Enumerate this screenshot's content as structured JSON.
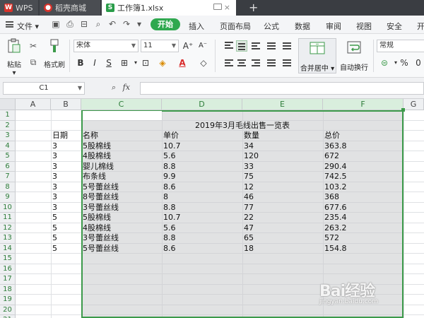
{
  "tabs": [
    {
      "label": "WPS"
    },
    {
      "label": "稻壳商城"
    },
    {
      "label": "工作簿1.xlsx"
    }
  ],
  "tab_close": "×",
  "new_tab": "+",
  "menu": {
    "file": "文件",
    "start": "开始",
    "items": [
      "插入",
      "页面布局",
      "公式",
      "数据",
      "审阅",
      "视图",
      "安全",
      "开"
    ]
  },
  "ribbon": {
    "paste": "粘贴",
    "format_painter": "格式刷",
    "font_name": "宋体",
    "font_size": "11",
    "grow_font": "A⁺",
    "shrink_font": "A⁻",
    "bold": "B",
    "italic": "I",
    "underline": "S",
    "merge_center": "合并居中",
    "wrap_text": "自动换行",
    "number_format": "常规",
    "percent": "%",
    "comma": "0"
  },
  "formula_bar": {
    "cell_ref": "C1",
    "fx": "fx"
  },
  "columns": [
    "A",
    "B",
    "C",
    "D",
    "E",
    "F",
    "G"
  ],
  "rows": [
    "1",
    "2",
    "3",
    "4",
    "5",
    "6",
    "7",
    "8",
    "9",
    "10",
    "11",
    "12",
    "13",
    "14",
    "15",
    "16",
    "17",
    "18",
    "19",
    "20",
    "21"
  ],
  "sheet": {
    "title": "2019年3月毛线出售一览表",
    "header": {
      "date": "日期",
      "name": "名称",
      "price": "单价",
      "qty": "数量",
      "total": "总价"
    },
    "records": [
      {
        "date": "3",
        "name": "5股棉线",
        "price": "10.7",
        "qty": "34",
        "total": "363.8"
      },
      {
        "date": "3",
        "name": "4股棉线",
        "price": "5.6",
        "qty": "120",
        "total": "672"
      },
      {
        "date": "3",
        "name": "婴儿棉线",
        "price": "8.8",
        "qty": "33",
        "total": "290.4"
      },
      {
        "date": "3",
        "name": "布条线",
        "price": "9.9",
        "qty": "75",
        "total": "742.5"
      },
      {
        "date": "3",
        "name": "5号蕾丝线",
        "price": "8.6",
        "qty": "12",
        "total": "103.2"
      },
      {
        "date": "3",
        "name": "8号蕾丝线",
        "price": "8",
        "qty": "46",
        "total": "368"
      },
      {
        "date": "3",
        "name": "3号蕾丝线",
        "price": "8.8",
        "qty": "77",
        "total": "677.6"
      },
      {
        "date": "5",
        "name": "5股棉线",
        "price": "10.7",
        "qty": "22",
        "total": "235.4"
      },
      {
        "date": "5",
        "name": "4股棉线",
        "price": "5.6",
        "qty": "47",
        "total": "263.2"
      },
      {
        "date": "5",
        "name": "3号蕾丝线",
        "price": "8.8",
        "qty": "65",
        "total": "572"
      },
      {
        "date": "5",
        "name": "5号蕾丝线",
        "price": "8.6",
        "qty": "18",
        "total": "154.8"
      }
    ]
  },
  "watermark": {
    "logo": "Bai经验",
    "url": "jingyan.baidu.com"
  },
  "colors": {
    "accent": "#2fa84f",
    "selection_border": "#3c9a4a",
    "titlebar": "#3a3d42"
  }
}
